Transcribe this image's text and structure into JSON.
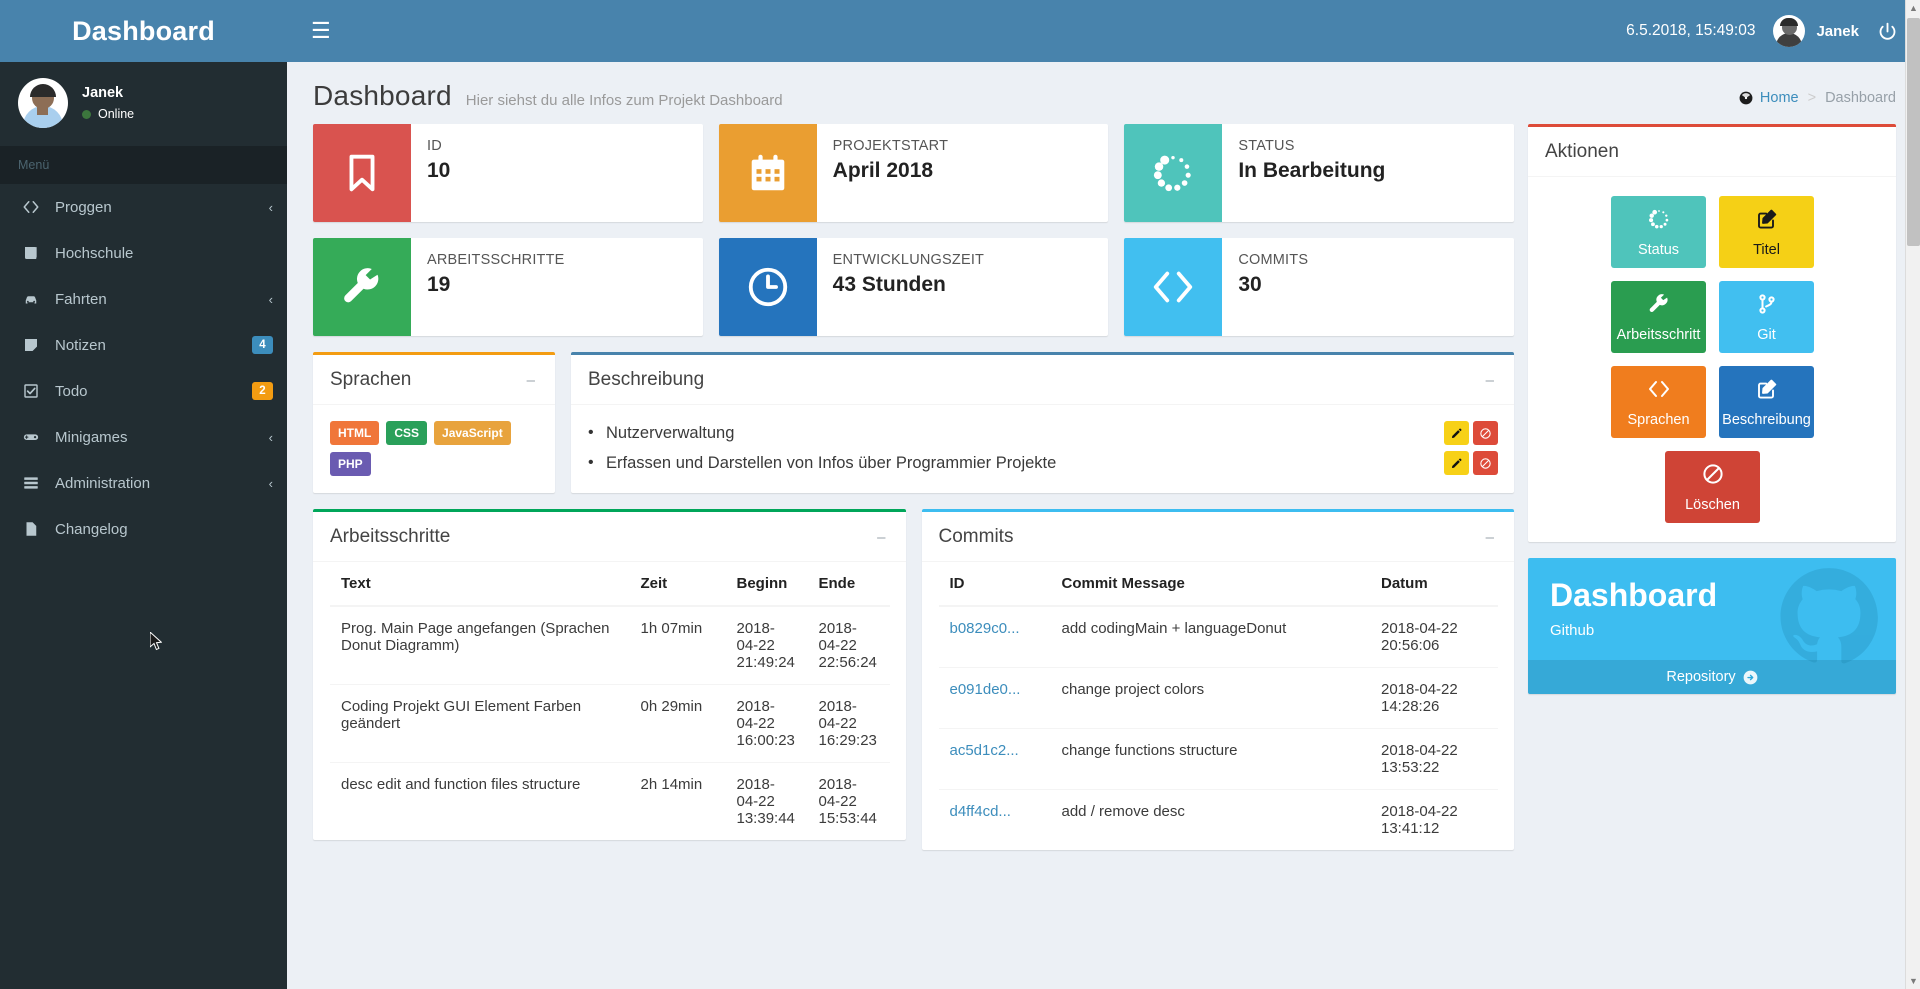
{
  "brand": {
    "logo_text": "Dashboard"
  },
  "sidebar": {
    "user": {
      "name": "Janek",
      "status": "Online"
    },
    "menu_header": "Menü",
    "items": [
      {
        "label": "Proggen",
        "icon": "code-icon",
        "chevron": "‹",
        "badge": null
      },
      {
        "label": "Hochschule",
        "icon": "book-icon",
        "chevron": null,
        "badge": null
      },
      {
        "label": "Fahrten",
        "icon": "car-icon",
        "chevron": "‹",
        "badge": null
      },
      {
        "label": "Notizen",
        "icon": "sticky-note-icon",
        "chevron": null,
        "badge": "4",
        "badge_color": "blue"
      },
      {
        "label": "Todo",
        "icon": "check-square-icon",
        "chevron": null,
        "badge": "2",
        "badge_color": "orange"
      },
      {
        "label": "Minigames",
        "icon": "gamepad-icon",
        "chevron": "‹",
        "badge": null
      },
      {
        "label": "Administration",
        "icon": "server-icon",
        "chevron": "‹",
        "badge": null
      },
      {
        "label": "Changelog",
        "icon": "file-icon",
        "chevron": null,
        "badge": null
      }
    ]
  },
  "topbar": {
    "menu_toggle": "☰",
    "clock": "6.5.2018, 15:49:03",
    "user_name": "Janek",
    "power_icon": "power-icon"
  },
  "header": {
    "title": "Dashboard",
    "subtitle": "Hier siehst du alle Infos zum Projekt Dashboard",
    "breadcrumb": {
      "home": "Home",
      "separator": ">",
      "current": "Dashboard"
    }
  },
  "stats": [
    {
      "label": "ID",
      "value": "10",
      "color": "#d9534f",
      "icon": "bookmark-icon"
    },
    {
      "label": "PROJEKTSTART",
      "value": "April 2018",
      "color": "#ea9e31",
      "icon": "calendar-icon"
    },
    {
      "label": "STATUS",
      "value": "In Bearbeitung",
      "color": "#4fc4bb",
      "icon": "spinner-icon"
    },
    {
      "label": "ARBEITSSCHRITTE",
      "value": "19",
      "color": "#35ab58",
      "icon": "wrench-icon"
    },
    {
      "label": "ENTWICKLUNGSZEIT",
      "value": "43 Stunden",
      "color": "#2574bd",
      "icon": "clock-icon"
    },
    {
      "label": "COMMITS",
      "value": "30",
      "color": "#41bff0",
      "icon": "code-icon"
    }
  ],
  "languages_panel": {
    "title": "Sprachen",
    "collapse_icon": "minus-icon",
    "badges": [
      {
        "label": "HTML",
        "color": "#f0763a"
      },
      {
        "label": "CSS",
        "color": "#2aa05a"
      },
      {
        "label": "JavaScript",
        "color": "#e8a33d"
      },
      {
        "label": "PHP",
        "color": "#6a5bb1"
      }
    ]
  },
  "description_panel": {
    "title": "Beschreibung",
    "collapse_icon": "minus-icon",
    "items": [
      {
        "text": "Nutzerverwaltung",
        "edit_icon": "pencil-icon",
        "delete_icon": "ban-icon"
      },
      {
        "text": "Erfassen und Darstellen von Infos über Programmier Projekte",
        "edit_icon": "pencil-icon",
        "delete_icon": "ban-icon"
      }
    ]
  },
  "steps_panel": {
    "title": "Arbeitsschritte",
    "collapse_icon": "minus-icon",
    "columns": [
      "Text",
      "Zeit",
      "Beginn",
      "Ende"
    ],
    "rows": [
      {
        "text": "Prog. Main Page angefangen (Sprachen Donut Diagramm)",
        "zeit": "1h 07min",
        "beginn": "2018-04-22 21:49:24",
        "ende": "2018-04-22 22:56:24"
      },
      {
        "text": "Coding Projekt GUI Element Farben geändert",
        "zeit": "0h 29min",
        "beginn": "2018-04-22 16:00:23",
        "ende": "2018-04-22 16:29:23"
      },
      {
        "text": "desc edit and function files structure",
        "zeit": "2h 14min",
        "beginn": "2018-04-22 13:39:44",
        "ende": "2018-04-22 15:53:44"
      }
    ]
  },
  "commits_panel": {
    "title": "Commits",
    "collapse_icon": "minus-icon",
    "columns": [
      "ID",
      "Commit Message",
      "Datum"
    ],
    "rows": [
      {
        "id": "b0829c0...",
        "message": "add codingMain + languageDonut",
        "datum": "2018-04-22 20:56:06"
      },
      {
        "id": "e091de0...",
        "message": "change project colors",
        "datum": "2018-04-22 14:28:26"
      },
      {
        "id": "ac5d1c2...",
        "message": "change functions structure",
        "datum": "2018-04-22 13:53:22"
      },
      {
        "id": "d4ff4cd...",
        "message": "add / remove desc",
        "datum": "2018-04-22 13:41:12"
      }
    ]
  },
  "actions_panel": {
    "title": "Aktionen",
    "buttons": [
      {
        "label": "Status",
        "color": "#4fc4bb",
        "icon": "spinner-icon",
        "text_dark": false
      },
      {
        "label": "Titel",
        "color": "#f5d016",
        "icon": "edit-square-icon",
        "text_dark": true
      },
      {
        "label": "Arbeitsschritt",
        "color": "#2a9d50",
        "icon": "wrench-icon",
        "text_dark": false
      },
      {
        "label": "Git",
        "color": "#41bff0",
        "icon": "git-branch-icon",
        "text_dark": false
      },
      {
        "label": "Sprachen",
        "color": "#f07d1e",
        "icon": "code-icon",
        "text_dark": false
      },
      {
        "label": "Beschreibung",
        "color": "#2574bd",
        "icon": "edit-square-icon",
        "text_dark": false
      },
      {
        "label": "Löschen",
        "color": "#cf4436",
        "icon": "ban-icon",
        "text_dark": false
      }
    ]
  },
  "github_card": {
    "title": "Dashboard",
    "subtitle": "Github",
    "footer_label": "Repository",
    "footer_icon": "arrow-circle-right-icon",
    "mark_icon": "github-icon",
    "color": "#3dbdf0"
  }
}
